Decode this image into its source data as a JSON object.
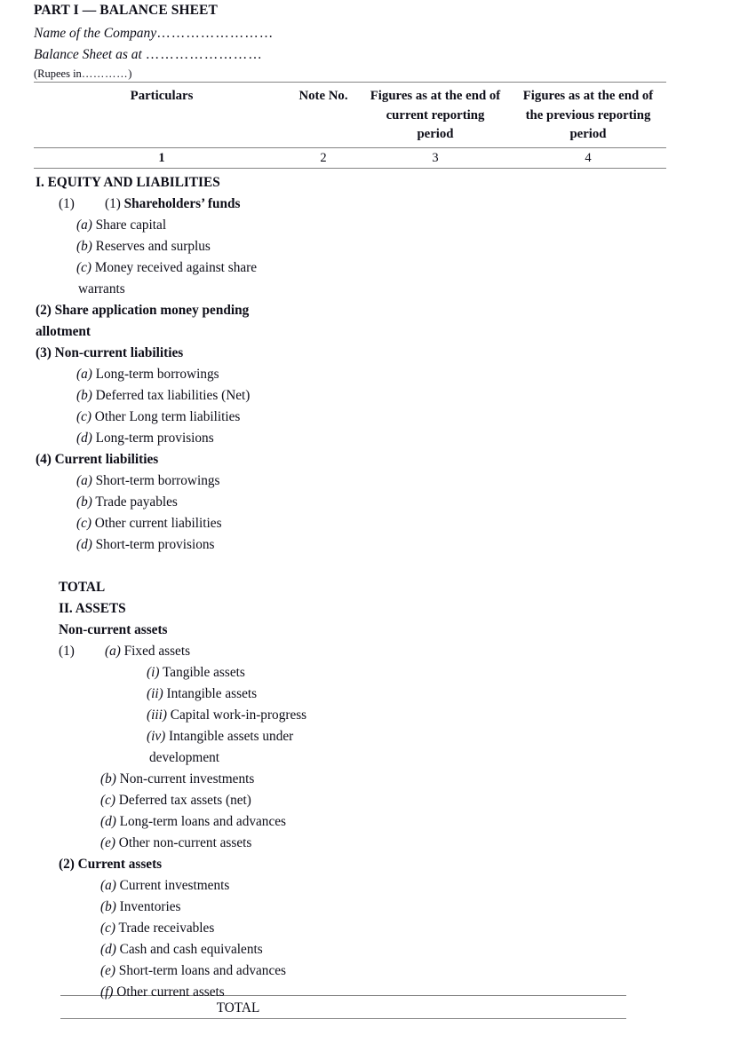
{
  "document": {
    "part_title": "PART I — BALANCE SHEET",
    "company_name_label": "Name of the Company",
    "company_name_leader": "……………………",
    "balance_sheet_label": "Balance Sheet as at ",
    "balance_sheet_leader": "……………………",
    "rupees_prefix": "(Rupees in",
    "rupees_dots": "…………",
    "rupees_suffix": ")"
  },
  "table": {
    "headers": [
      "Particulars",
      "Note No.",
      "Figures as at the end of current reporting period",
      "Figures as at the end of the previous reporting period"
    ],
    "column_numbers": [
      "1",
      "2",
      "3",
      "4"
    ],
    "final_total_label": "TOTAL"
  },
  "rows": [
    {
      "id": "equity-and-liabilities",
      "indent": "ind-0",
      "bold": true,
      "text": "I. EQUITY AND LIABILITIES"
    },
    {
      "id": "shareholders-funds",
      "indent": "ind-0",
      "bold": false,
      "marker": "(1)",
      "marker_bold_text": "Shareholders’ funds",
      "text": "(1) Shareholders’ funds"
    },
    {
      "id": "share-capital",
      "indent": "ind-2",
      "bold": false,
      "text": "(a) Share capital"
    },
    {
      "id": "reserves-and-surplus",
      "indent": "ind-2",
      "bold": false,
      "text": "(b) Reserves and surplus"
    },
    {
      "id": "money-received-against-share",
      "indent": "ind-2",
      "bold": false,
      "text": "(c) Money received against share"
    },
    {
      "id": "warrants-continuation",
      "indent": "ind-2b",
      "bold": false,
      "text": "warrants"
    },
    {
      "id": "share-application-money-pending",
      "indent": "ind-0",
      "bold": true,
      "text": "(2) Share application money pending"
    },
    {
      "id": "allotment-continuation",
      "indent": "ind-0",
      "bold": true,
      "text": "allotment"
    },
    {
      "id": "non-current-liabilities",
      "indent": "ind-0",
      "bold": true,
      "text": "(3) Non-current liabilities"
    },
    {
      "id": "long-term-borrowings",
      "indent": "ind-2",
      "bold": false,
      "text": "(a) Long-term borrowings"
    },
    {
      "id": "deferred-tax-liabilities",
      "indent": "ind-2",
      "bold": false,
      "text": "(b) Deferred tax liabilities (Net)"
    },
    {
      "id": "other-long-term-liabilities",
      "indent": "ind-2",
      "bold": false,
      "text": "(c) Other Long term liabilities"
    },
    {
      "id": "long-term-provisions",
      "indent": "ind-2",
      "bold": false,
      "text": "(d) Long-term provisions"
    },
    {
      "id": "current-liabilities",
      "indent": "ind-0",
      "bold": true,
      "text": "(4) Current liabilities"
    },
    {
      "id": "short-term-borrowings",
      "indent": "ind-2",
      "bold": false,
      "text": "(a) Short-term borrowings"
    },
    {
      "id": "trade-payables",
      "indent": "ind-2",
      "bold": false,
      "text": "(b) Trade payables"
    },
    {
      "id": "other-current-liabilities",
      "indent": "ind-2",
      "bold": false,
      "text": "(c) Other current liabilities"
    },
    {
      "id": "short-term-provisions",
      "indent": "ind-2",
      "bold": false,
      "text": "(d) Short-term provisions"
    },
    {
      "id": "spacer-1",
      "indent": "ind-0",
      "bold": false,
      "text": ""
    },
    {
      "id": "total-equity-liabilities",
      "indent": "ind-1",
      "bold": true,
      "text": "TOTAL"
    },
    {
      "id": "assets-heading",
      "indent": "ind-1",
      "bold": true,
      "text": "II. ASSETS"
    },
    {
      "id": "non-current-assets",
      "indent": "ind-1",
      "bold": true,
      "text": "Non-current assets"
    },
    {
      "id": "fixed-assets",
      "indent": "ind-4",
      "bold": false,
      "marker": "(1)",
      "text": "(a) Fixed assets"
    },
    {
      "id": "tangible-assets",
      "indent": "ind-5",
      "bold": false,
      "text": "(i) Tangible assets"
    },
    {
      "id": "intangible-assets",
      "indent": "ind-5",
      "bold": false,
      "text": "(ii) Intangible assets"
    },
    {
      "id": "capital-work-in-progress",
      "indent": "ind-5",
      "bold": false,
      "text": "(iii) Capital work-in-progress"
    },
    {
      "id": "intangible-assets-under",
      "indent": "ind-5",
      "bold": false,
      "text": "(iv) Intangible assets under"
    },
    {
      "id": "development-continuation",
      "indent": "ind-5b",
      "bold": false,
      "text": "development"
    },
    {
      "id": "non-current-investments",
      "indent": "ind-3",
      "bold": false,
      "text": "(b) Non-current investments"
    },
    {
      "id": "deferred-tax-assets",
      "indent": "ind-3",
      "bold": false,
      "text": "(c) Deferred tax assets (net)"
    },
    {
      "id": "long-term-loans-and-advances",
      "indent": "ind-3",
      "bold": false,
      "text": "(d) Long-term loans and advances"
    },
    {
      "id": "other-non-current-assets",
      "indent": "ind-3",
      "bold": false,
      "text": "(e) Other non-current assets"
    },
    {
      "id": "current-assets",
      "indent": "ind-1",
      "bold": true,
      "text": "(2) Current assets"
    },
    {
      "id": "current-investments",
      "indent": "ind-3",
      "bold": false,
      "text": "(a) Current investments"
    },
    {
      "id": "inventories",
      "indent": "ind-3",
      "bold": false,
      "text": "(b) Inventories"
    },
    {
      "id": "trade-receivables",
      "indent": "ind-3",
      "bold": false,
      "text": "(c) Trade receivables"
    },
    {
      "id": "cash-and-cash-equivalents",
      "indent": "ind-3",
      "bold": false,
      "text": "(d) Cash and cash equivalents"
    },
    {
      "id": "short-term-loans-and-advances",
      "indent": "ind-3",
      "bold": false,
      "text": "(e) Short-term loans and advances"
    },
    {
      "id": "other-current-assets",
      "indent": "ind-3",
      "bold": false,
      "text": "(f) Other current assets"
    }
  ]
}
